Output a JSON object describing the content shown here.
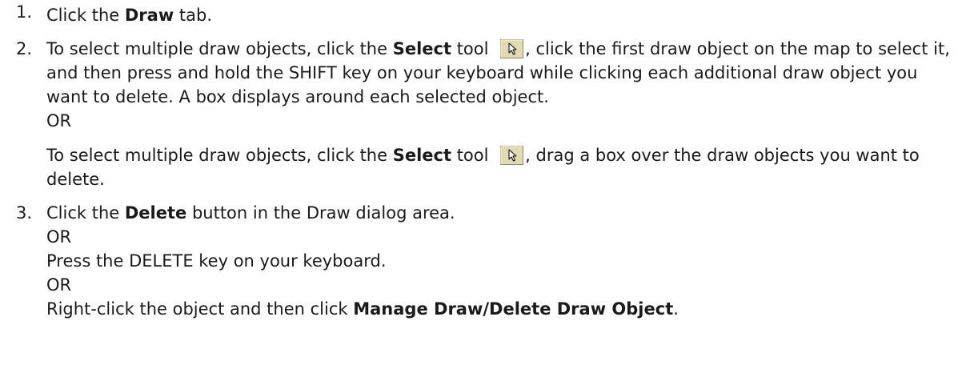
{
  "steps": [
    {
      "number": "1.",
      "pre": "Click the ",
      "bold": "Draw",
      "post": " tab."
    },
    {
      "number": "2.",
      "a_pre": "To select multiple draw objects, click the ",
      "a_bold": "Select",
      "a_tool": " tool ",
      "a_post": ", click the first draw object on the map to select it, and then press and hold the SHIFT key on your keyboard while clicking each additional draw object you want to delete. A box displays around each selected object.",
      "or": "OR",
      "b_pre": "To select multiple draw objects, click the ",
      "b_bold": "Select",
      "b_tool": " tool ",
      "b_post": ", drag a box over the draw objects you want to delete."
    },
    {
      "number": "3.",
      "pre": "Click the ",
      "bold": "Delete",
      "post": " button in the Draw dialog area.",
      "or1": "OR",
      "alt1": "Press the DELETE key on your keyboard.",
      "or2": "OR",
      "alt2_pre": "Right-click the object and then click ",
      "alt2_bold": "Manage Draw/Delete Draw Object",
      "alt2_post": "."
    }
  ],
  "icons": {
    "select_tool": "select-tool-cursor-icon",
    "button_face": "#e3d9b4",
    "button_border": "#8c8c6c"
  }
}
